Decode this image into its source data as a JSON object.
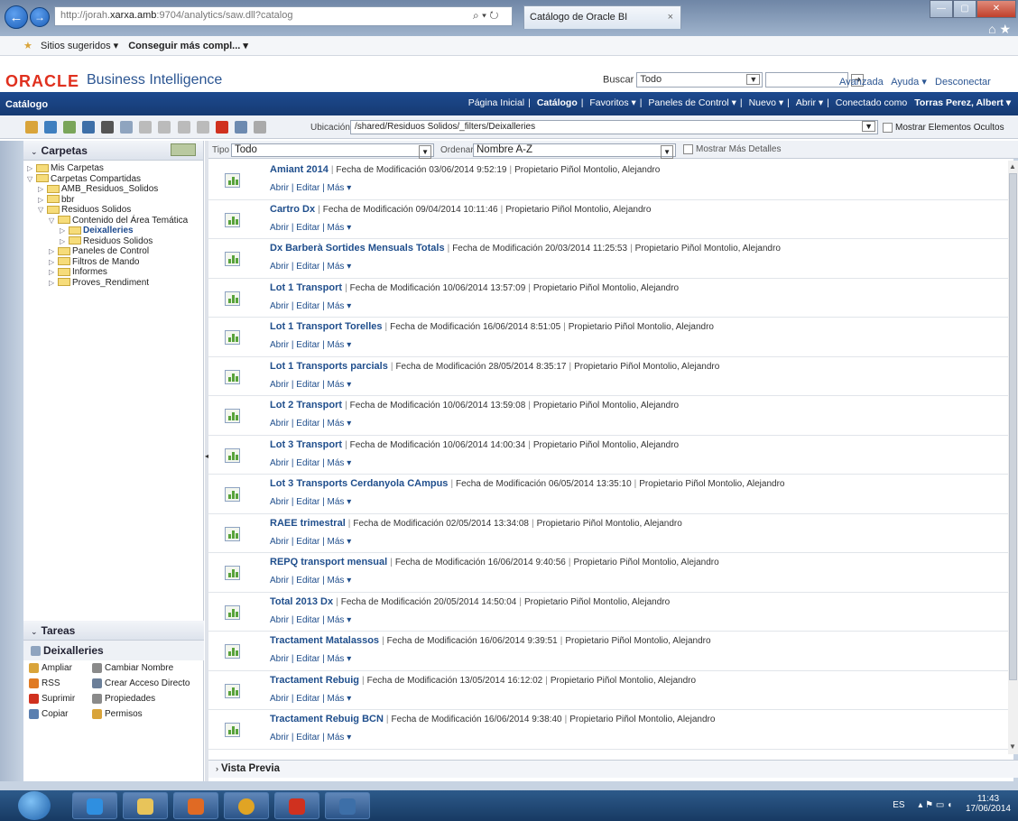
{
  "browser": {
    "address_prefix": "http://jorah.",
    "address_host": "xarxa.amb",
    "address_rest": ":9704/analytics/saw.dll?catalog",
    "tab_title": "Catálogo de Oracle BI",
    "favorites": [
      "Sitios sugeridos ▾",
      "Conseguir más compl... ▾"
    ]
  },
  "header": {
    "logo": "ORACLE",
    "product": "Business Intelligence",
    "search_label": "Buscar",
    "search_scope": "Todo",
    "links": [
      "Avanzada",
      "Ayuda ▾",
      "Desconectar"
    ]
  },
  "nav": {
    "section": "Catálogo",
    "items": [
      "Página Inicial",
      "Catálogo",
      "Favoritos ▾",
      "Paneles de Control ▾",
      "Nuevo ▾",
      "Abrir ▾"
    ],
    "connected_label": "Conectado como",
    "user": "Torras Perez, Albert ▾"
  },
  "toolbar": {
    "location_label": "Ubicación",
    "location_path": "/shared/Residuos Solidos/_filters/Deixalleries",
    "show_hidden": "Mostrar Elementos Ocultos"
  },
  "folders": {
    "title": "Carpetas",
    "tree": [
      {
        "label": "Mis Carpetas",
        "indent": 0,
        "toggle": "▷"
      },
      {
        "label": "Carpetas Compartidas",
        "indent": 0,
        "toggle": "▽"
      },
      {
        "label": "AMB_Residuos_Solidos",
        "indent": 1,
        "toggle": "▷"
      },
      {
        "label": "bbr",
        "indent": 1,
        "toggle": "▷"
      },
      {
        "label": "Residuos Solidos",
        "indent": 1,
        "toggle": "▽"
      },
      {
        "label": "Contenido del Área Temática",
        "indent": 2,
        "toggle": "▽"
      },
      {
        "label": "Deixalleries",
        "indent": 3,
        "toggle": "▷",
        "selected": true
      },
      {
        "label": "Residuos Solidos",
        "indent": 3,
        "toggle": "▷"
      },
      {
        "label": "Paneles de Control",
        "indent": 2,
        "toggle": "▷"
      },
      {
        "label": "Filtros de Mando",
        "indent": 2,
        "toggle": "▷"
      },
      {
        "label": "Informes",
        "indent": 2,
        "toggle": "▷"
      },
      {
        "label": "Proves_Rendiment",
        "indent": 2,
        "toggle": "▷"
      }
    ]
  },
  "tasks": {
    "title": "Tareas",
    "selected_item": "Deixalleries",
    "items": [
      {
        "label": "Ampliar",
        "color": "#d9a43a"
      },
      {
        "label": "Cambiar Nombre",
        "color": "#8a8a8a"
      },
      {
        "label": "RSS",
        "color": "#e07b24"
      },
      {
        "label": "Crear Acceso Directo",
        "color": "#6b7f99"
      },
      {
        "label": "Suprimir",
        "color": "#d0311f"
      },
      {
        "label": "Propiedades",
        "color": "#8a8a8a"
      },
      {
        "label": "Copiar",
        "color": "#5a7fb0"
      },
      {
        "label": "Permisos",
        "color": "#d9a43a"
      }
    ]
  },
  "filter": {
    "type_label": "Tipo",
    "type_value": "Todo",
    "order_label": "Ordenar",
    "order_value": "Nombre A-Z",
    "more_details": "Mostrar Más Detalles"
  },
  "list_labels": {
    "modified": "Fecha de Modificación",
    "owner": "Propietario",
    "actions": "Abrir | Editar | Más ▾"
  },
  "items": [
    {
      "name": "Amiant 2014",
      "date": "03/06/2014 9:52:19",
      "owner": "Piñol Montolio, Alejandro"
    },
    {
      "name": "Cartro Dx",
      "date": "09/04/2014 10:11:46",
      "owner": "Piñol Montolio, Alejandro"
    },
    {
      "name": "Dx Barberà Sortides Mensuals Totals",
      "date": "20/03/2014 11:25:53",
      "owner": "Piñol Montolio, Alejandro"
    },
    {
      "name": "Lot 1 Transport",
      "date": "10/06/2014 13:57:09",
      "owner": "Piñol Montolio, Alejandro"
    },
    {
      "name": "Lot 1 Transport Torelles",
      "date": "16/06/2014 8:51:05",
      "owner": "Piñol Montolio, Alejandro"
    },
    {
      "name": "Lot 1 Transports parcials",
      "date": "28/05/2014 8:35:17",
      "owner": "Piñol Montolio, Alejandro"
    },
    {
      "name": "Lot 2 Transport",
      "date": "10/06/2014 13:59:08",
      "owner": "Piñol Montolio, Alejandro"
    },
    {
      "name": "Lot 3 Transport",
      "date": "10/06/2014 14:00:34",
      "owner": "Piñol Montolio, Alejandro"
    },
    {
      "name": "Lot 3 Transports Cerdanyola CAmpus",
      "date": "06/05/2014 13:35:10",
      "owner": "Piñol Montolio, Alejandro"
    },
    {
      "name": "RAEE trimestral",
      "date": "02/05/2014 13:34:08",
      "owner": "Piñol Montolio, Alejandro"
    },
    {
      "name": "REPQ transport mensual",
      "date": "16/06/2014 9:40:56",
      "owner": "Piñol Montolio, Alejandro"
    },
    {
      "name": "Total 2013 Dx",
      "date": "20/05/2014 14:50:04",
      "owner": "Piñol Montolio, Alejandro"
    },
    {
      "name": "Tractament Matalassos",
      "date": "16/06/2014 9:39:51",
      "owner": "Piñol Montolio, Alejandro"
    },
    {
      "name": "Tractament Rebuig",
      "date": "13/05/2014 16:12:02",
      "owner": "Piñol Montolio, Alejandro"
    },
    {
      "name": "Tractament Rebuig BCN",
      "date": "16/06/2014 9:38:40",
      "owner": "Piñol Montolio, Alejandro"
    }
  ],
  "preview": {
    "label": "Vista Previa"
  },
  "taskbar": {
    "lang": "ES",
    "time": "11:43",
    "date": "17/06/2014"
  }
}
